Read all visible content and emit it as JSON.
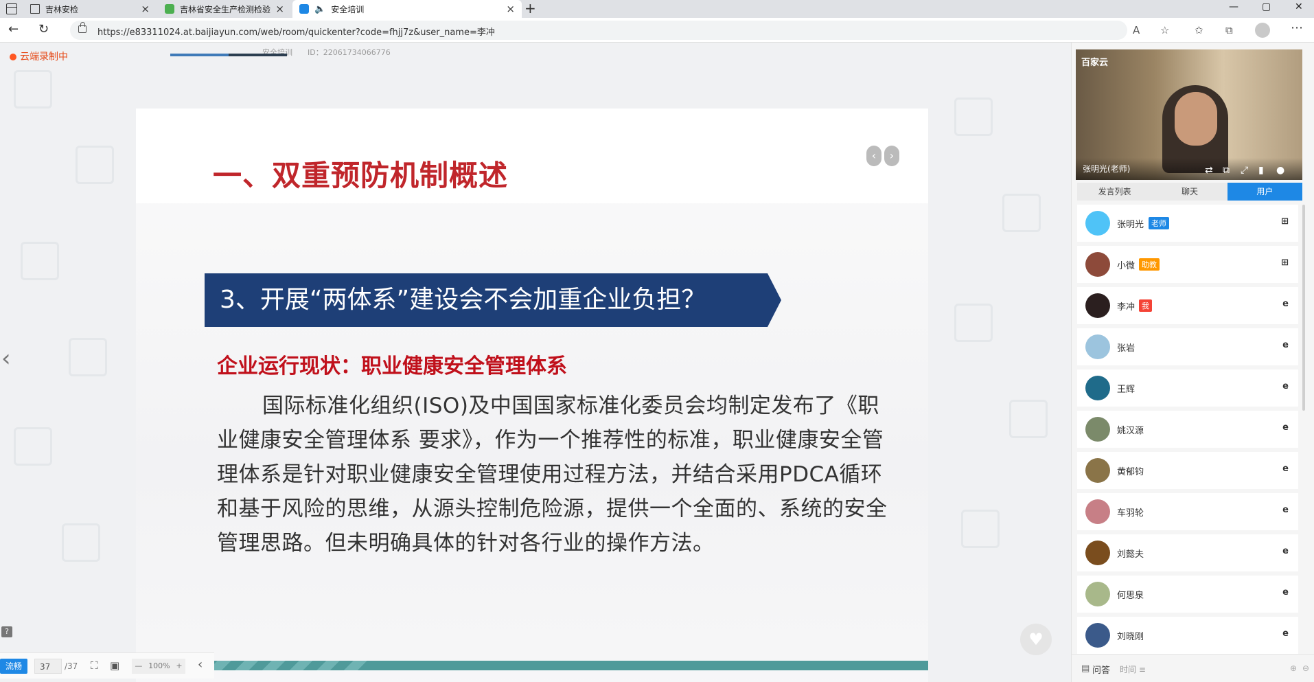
{
  "browser": {
    "tabs": [
      {
        "title": "吉林安检",
        "close": "×"
      },
      {
        "title": "吉林省安全生产检测检验中心有",
        "close": "×"
      },
      {
        "title": "安全培训",
        "close": "×"
      }
    ],
    "new_tab": "+",
    "url": "https://e83311024.at.baijiayun.com/web/room/quickenter?code=fhjj7z&user_name=李冲",
    "window_controls": [
      "—",
      "▢",
      "✕"
    ]
  },
  "room": {
    "recording_label": "云端录制中",
    "course_name": "安全培训",
    "room_id": "ID：22061734066776"
  },
  "slide": {
    "title": "一、双重预防机制概述",
    "nav_prev": "‹",
    "nav_next": "›",
    "banner": "3、开展“两体系”建设会不会加重企业负担？",
    "subheading": "企业运行现状：职业健康安全管理体系",
    "paragraph": "国际标准化组织(ISO)及中国国家标准化委员会均制定发布了《职业健康安全管理体系 要求》，作为一个推荐性的标准，职业健康安全管理体系是针对职业健康安全管理使用过程方法，并结合采用PDCA循环和基于风险的思维，从源头控制危险源，提供一个全面的、系统的安全管理思路。但未明确具体的针对各行业的操作方法。"
  },
  "toolbar": {
    "stream_label": "流畅",
    "current_page": "37",
    "total_pages": "/37",
    "zoom": "100%",
    "zoom_minus": "—",
    "zoom_plus": "+",
    "help": "?"
  },
  "video": {
    "logo": "百家云",
    "speaker_name": "张明光(老师)"
  },
  "sidebar": {
    "tabs": [
      "发言列表",
      "聊天",
      "用户"
    ],
    "active_tab": "用户",
    "users": [
      {
        "name": "张明光",
        "badge": "老师",
        "badge_color": "#1e88e5",
        "device": "⊞",
        "avatar_color": "#4fc3f7"
      },
      {
        "name": "小微",
        "badge": "助教",
        "badge_color": "#ff9800",
        "device": "⊞",
        "avatar_color": "#8d4a3a"
      },
      {
        "name": "李冲",
        "badge": "我",
        "badge_color": "#f44336",
        "device": "e",
        "avatar_color": "#2b1f1f"
      },
      {
        "name": "张岩",
        "badge": "",
        "badge_color": "",
        "device": "e",
        "avatar_color": "#9cc4de"
      },
      {
        "name": "王辉",
        "badge": "",
        "badge_color": "",
        "device": "e",
        "avatar_color": "#1f6b8a"
      },
      {
        "name": "姚汉源",
        "badge": "",
        "badge_color": "",
        "device": "e",
        "avatar_color": "#7b8a6a"
      },
      {
        "name": "黄郁钧",
        "badge": "",
        "badge_color": "",
        "device": "e",
        "avatar_color": "#8a7448"
      },
      {
        "name": "车羽轮",
        "badge": "",
        "badge_color": "",
        "device": "e",
        "avatar_color": "#c77f86"
      },
      {
        "name": "刘懿夫",
        "badge": "",
        "badge_color": "",
        "device": "e",
        "avatar_color": "#7a4d1e"
      },
      {
        "name": "何思泉",
        "badge": "",
        "badge_color": "",
        "device": "e",
        "avatar_color": "#a8b88a"
      },
      {
        "name": "刘晓刚",
        "badge": "",
        "badge_color": "",
        "device": "e",
        "avatar_color": "#3b5a8a"
      }
    ],
    "qa_label": "问答",
    "qa_sort": "时间 ≡",
    "colors": {
      "accent": "#1e88e5",
      "title_red": "#c0262b",
      "banner_blue": "#1e3f77"
    }
  }
}
